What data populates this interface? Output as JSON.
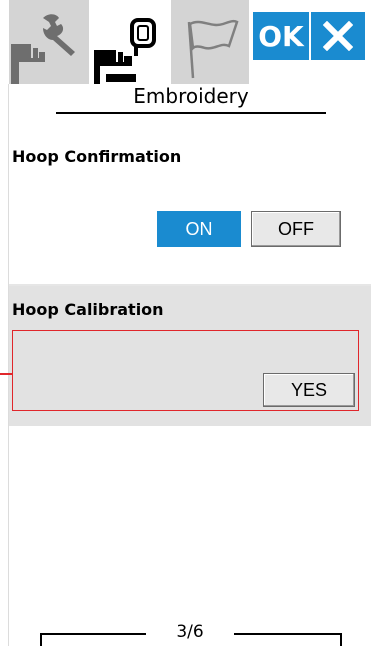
{
  "toolbar": {
    "tabs": [
      {
        "icon": "sewing-machine-wrench-icon",
        "selected": false
      },
      {
        "icon": "sewing-machine-embroidery-icon",
        "selected": true
      },
      {
        "icon": "flag-icon",
        "selected": false
      }
    ],
    "ok_label": "OK",
    "close_icon": "close-icon",
    "accent_color": "#1a8bd0"
  },
  "title": "Embroidery",
  "hoop_confirmation": {
    "label": "Hoop Confirmation",
    "on_label": "ON",
    "off_label": "OFF",
    "selected": "ON"
  },
  "hoop_calibration": {
    "label": "Hoop Calibration",
    "yes_label": "YES",
    "highlight_color": "#e0262b"
  },
  "pager": {
    "text": "3/6"
  }
}
